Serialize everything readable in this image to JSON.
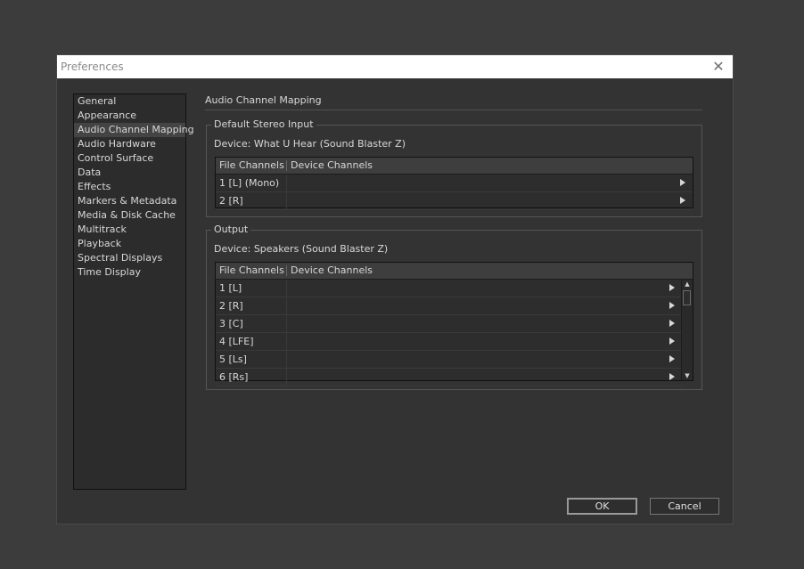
{
  "window": {
    "title": "Preferences",
    "close_glyph": "✕"
  },
  "sidebar": {
    "items": [
      {
        "label": "General"
      },
      {
        "label": "Appearance"
      },
      {
        "label": "Audio Channel Mapping",
        "selected": true
      },
      {
        "label": "Audio Hardware"
      },
      {
        "label": "Control Surface"
      },
      {
        "label": "Data"
      },
      {
        "label": "Effects"
      },
      {
        "label": "Markers & Metadata"
      },
      {
        "label": "Media & Disk Cache"
      },
      {
        "label": "Multitrack"
      },
      {
        "label": "Playback"
      },
      {
        "label": "Spectral Displays"
      },
      {
        "label": "Time Display"
      }
    ]
  },
  "main": {
    "title": "Audio Channel Mapping",
    "input_group": {
      "legend": "Default Stereo Input",
      "device": "Device: What U Hear (Sound Blaster Z)",
      "headers": {
        "file": "File Channels",
        "device": "Device Channels"
      },
      "rows": [
        {
          "file": "1 [L] (Mono)",
          "device": ""
        },
        {
          "file": "2 [R]",
          "device": ""
        }
      ]
    },
    "output_group": {
      "legend": "Output",
      "device": "Device: Speakers (Sound Blaster Z)",
      "headers": {
        "file": "File Channels",
        "device": "Device Channels"
      },
      "rows": [
        {
          "file": "1 [L]",
          "device": ""
        },
        {
          "file": "2 [R]",
          "device": ""
        },
        {
          "file": "3 [C]",
          "device": ""
        },
        {
          "file": "4 [LFE]",
          "device": ""
        },
        {
          "file": "5 [Ls]",
          "device": ""
        },
        {
          "file": "6 [Rs]",
          "device": ""
        }
      ]
    }
  },
  "buttons": {
    "ok": "OK",
    "cancel": "Cancel"
  },
  "icons": {
    "close": "close-icon",
    "expand": "expand-arrow-icon",
    "scroll_up": "scroll-up-icon",
    "scroll_down": "scroll-down-icon"
  },
  "colors": {
    "desktop": "#3c3c3c",
    "dialog": "#333333",
    "titlebar": "#ffffff",
    "selected_item": "#444444"
  }
}
